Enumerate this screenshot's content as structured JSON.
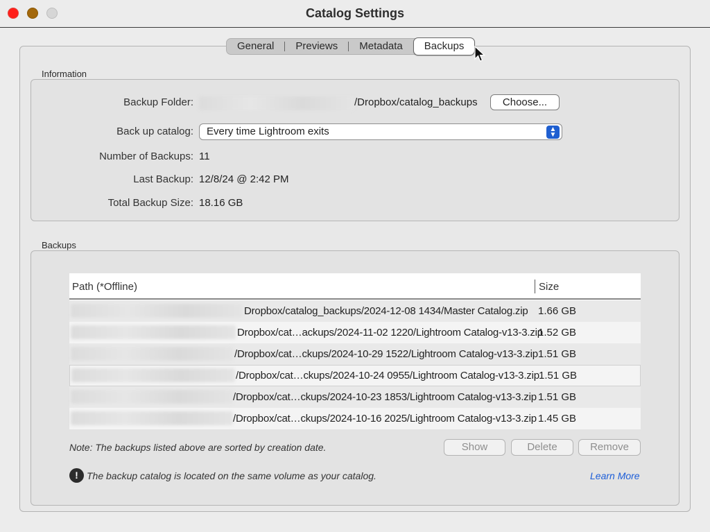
{
  "window": {
    "title": "Catalog Settings"
  },
  "tabs": [
    {
      "label": "General"
    },
    {
      "label": "Previews"
    },
    {
      "label": "Metadata"
    },
    {
      "label": "Backups",
      "active": true
    }
  ],
  "information": {
    "group_label": "Information",
    "backup_folder_label": "Backup Folder:",
    "backup_folder_value": "/Dropbox/catalog_backups",
    "choose_button": "Choose...",
    "backup_catalog_label": "Back up catalog:",
    "backup_catalog_value": "Every time Lightroom exits",
    "num_backups_label": "Number of Backups:",
    "num_backups_value": "11",
    "last_backup_label": "Last Backup:",
    "last_backup_value": "12/8/24 @ 2:42 PM",
    "total_size_label": "Total Backup Size:",
    "total_size_value": "18.16 GB"
  },
  "backups": {
    "group_label": "Backups",
    "columns": [
      "Path (*Offline)",
      "Size"
    ],
    "rows": [
      {
        "path": "Dropbox/catalog_backups/2024-12-08 1434/Master Catalog.zip",
        "size": "1.66 GB"
      },
      {
        "path": "Dropbox/cat…ackups/2024-11-02 1220/Lightroom Catalog-v13-3.zip",
        "size": "1.52 GB"
      },
      {
        "path": "/Dropbox/cat…ckups/2024-10-29 1522/Lightroom Catalog-v13-3.zip",
        "size": "1.51 GB"
      },
      {
        "path": "/Dropbox/cat…ckups/2024-10-24 0955/Lightroom Catalog-v13-3.zip",
        "size": "1.51 GB"
      },
      {
        "path": "/Dropbox/cat…ckups/2024-10-23 1853/Lightroom Catalog-v13-3.zip",
        "size": "1.51 GB"
      },
      {
        "path": "/Dropbox/cat…ckups/2024-10-16 2025/Lightroom Catalog-v13-3.zip",
        "size": "1.45 GB"
      }
    ],
    "note": "Note: The backups listed above are sorted by creation date.",
    "show_button": "Show",
    "delete_button": "Delete",
    "remove_button": "Remove",
    "warning_text": "The backup catalog is located on the same volume as your catalog.",
    "warning_icon": "!",
    "learn_more": "Learn More"
  }
}
